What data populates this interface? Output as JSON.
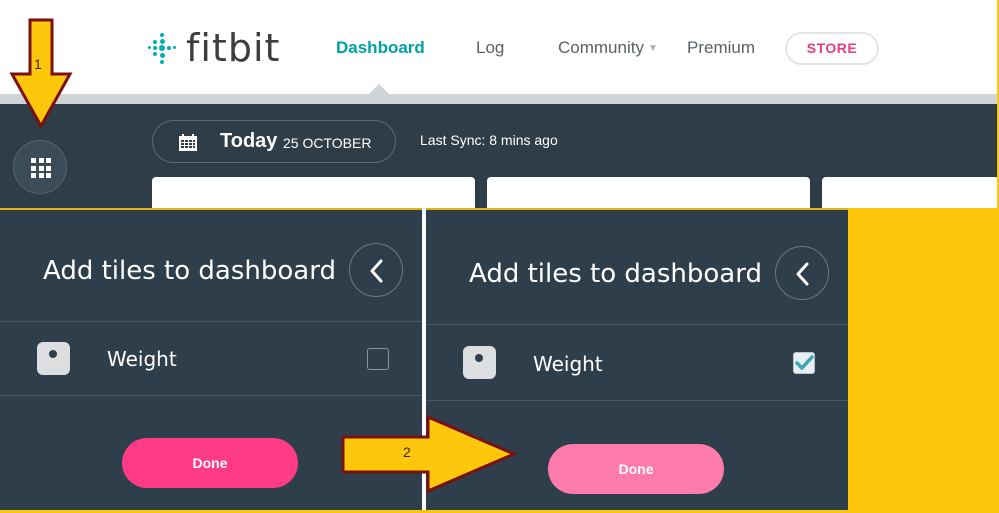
{
  "nav": {
    "logo": "fitbit",
    "links": [
      "Dashboard",
      "Log",
      "Community",
      "Premium"
    ],
    "store": "STORE"
  },
  "dashboard": {
    "today": "Today",
    "date": "25 OCTOBER",
    "last_sync": "Last Sync: 8 mins ago"
  },
  "panels": [
    {
      "title": "Add tiles to dashboard",
      "item_label": "Weight",
      "checked": false,
      "done_label": "Done",
      "done_color": "#ff3b86"
    },
    {
      "title": "Add tiles to dashboard",
      "item_label": "Weight",
      "checked": true,
      "done_label": "Done",
      "done_color": "#ff7bab"
    }
  ],
  "annotations": {
    "arrow1_label": "1",
    "arrow2_label": "2",
    "arrow_color": "#fec70c",
    "arrow_outline": "#7a1010"
  },
  "colors": {
    "accent": "#00a0a8",
    "dark_bg": "#2e3d48",
    "store": "#e73c7e"
  }
}
